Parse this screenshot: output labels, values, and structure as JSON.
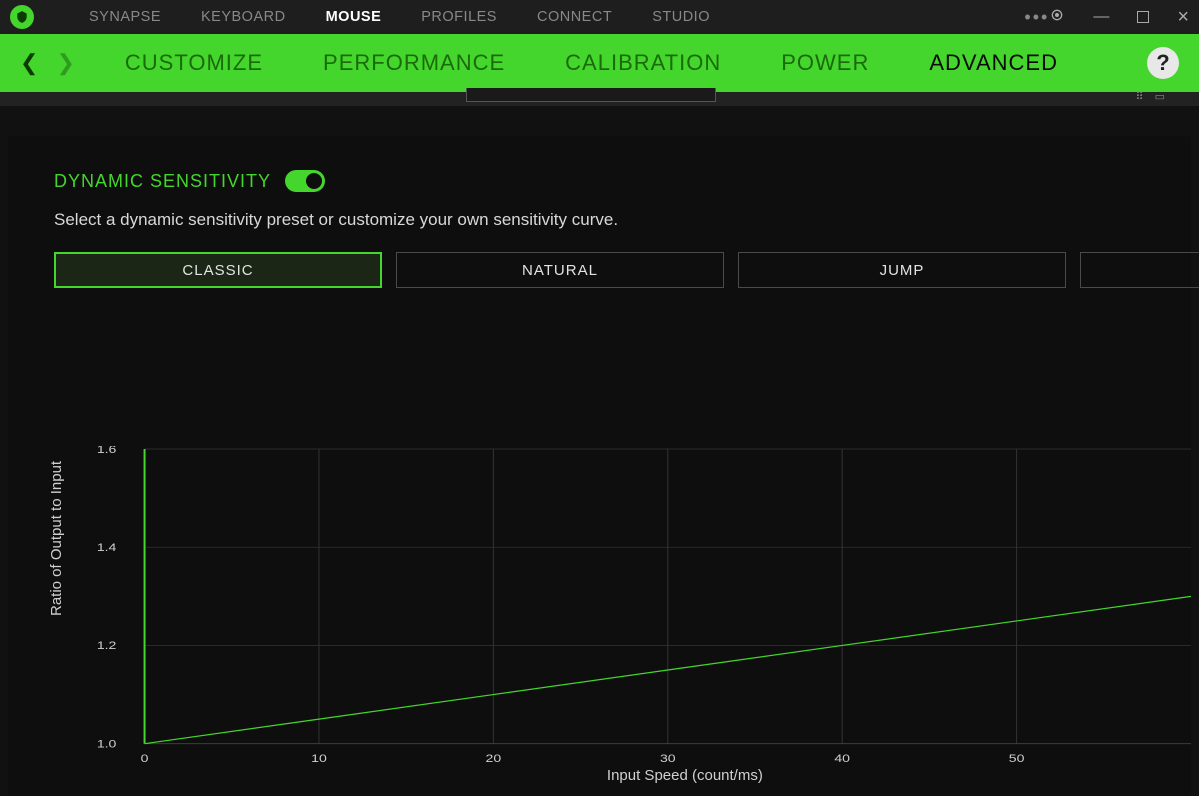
{
  "app": {
    "tabs": [
      "SYNAPSE",
      "KEYBOARD",
      "MOUSE",
      "PROFILES",
      "CONNECT",
      "STUDIO"
    ],
    "active_tab_index": 2
  },
  "subnav": {
    "tabs": [
      "CUSTOMIZE",
      "PERFORMANCE",
      "CALIBRATION",
      "POWER",
      "ADVANCED"
    ],
    "active_tab_index": 4
  },
  "section": {
    "title": "DYNAMIC SENSITIVITY",
    "toggle_on": true,
    "description": "Select a dynamic sensitivity preset or customize your own sensitivity curve.",
    "presets": [
      "CLASSIC",
      "NATURAL",
      "JUMP",
      ""
    ],
    "active_preset_index": 0
  },
  "chart_data": {
    "type": "line",
    "title": "",
    "xlabel": "Input Speed (count/ms)",
    "ylabel": "Ratio of Output to Input",
    "xlim": [
      0,
      60
    ],
    "ylim": [
      1.0,
      1.6
    ],
    "x_ticks": [
      0,
      10,
      20,
      30,
      40,
      50
    ],
    "y_ticks": [
      1.0,
      1.2,
      1.4,
      1.6
    ],
    "series": [
      {
        "name": "Classic",
        "color": "#44d62c",
        "x": [
          0,
          10,
          20,
          30,
          40,
          50,
          60
        ],
        "values": [
          1.0,
          1.05,
          1.1,
          1.15,
          1.2,
          1.25,
          1.3
        ]
      }
    ]
  }
}
